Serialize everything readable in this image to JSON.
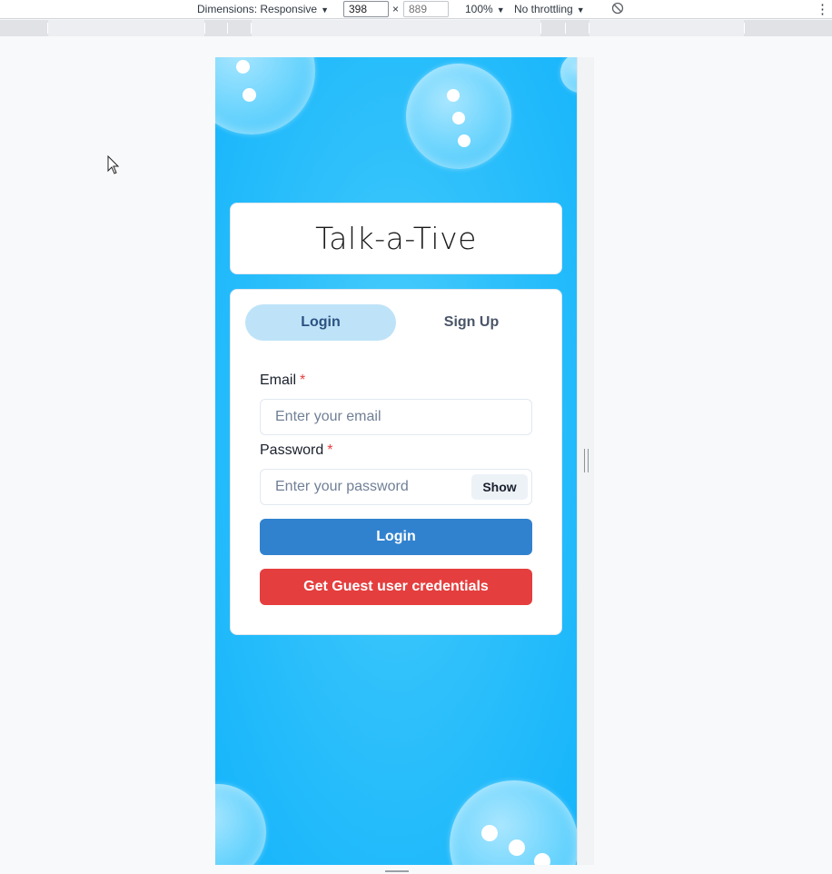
{
  "devtools": {
    "dimensions_label": "Dimensions: Responsive",
    "width_value": "398",
    "times_sign": "×",
    "height_placeholder": "889",
    "zoom": "100%",
    "throttling": "No throttling",
    "caret": "▼",
    "menu_icon": "⋮"
  },
  "app": {
    "title": "Talk-a-Tive",
    "tabs": [
      {
        "label": "Login",
        "active": true
      },
      {
        "label": "Sign Up",
        "active": false
      }
    ],
    "email": {
      "label": "Email",
      "required_mark": "*",
      "placeholder": "Enter your email"
    },
    "password": {
      "label": "Password",
      "required_mark": "*",
      "placeholder": "Enter your password",
      "show_label": "Show"
    },
    "login_button": "Login",
    "guest_button": "Get Guest user credentials",
    "colors": {
      "primary": "#3182ce",
      "danger": "#e53e3e",
      "tab_active_bg": "#bee3f8",
      "background": "#1eb8fb"
    }
  }
}
